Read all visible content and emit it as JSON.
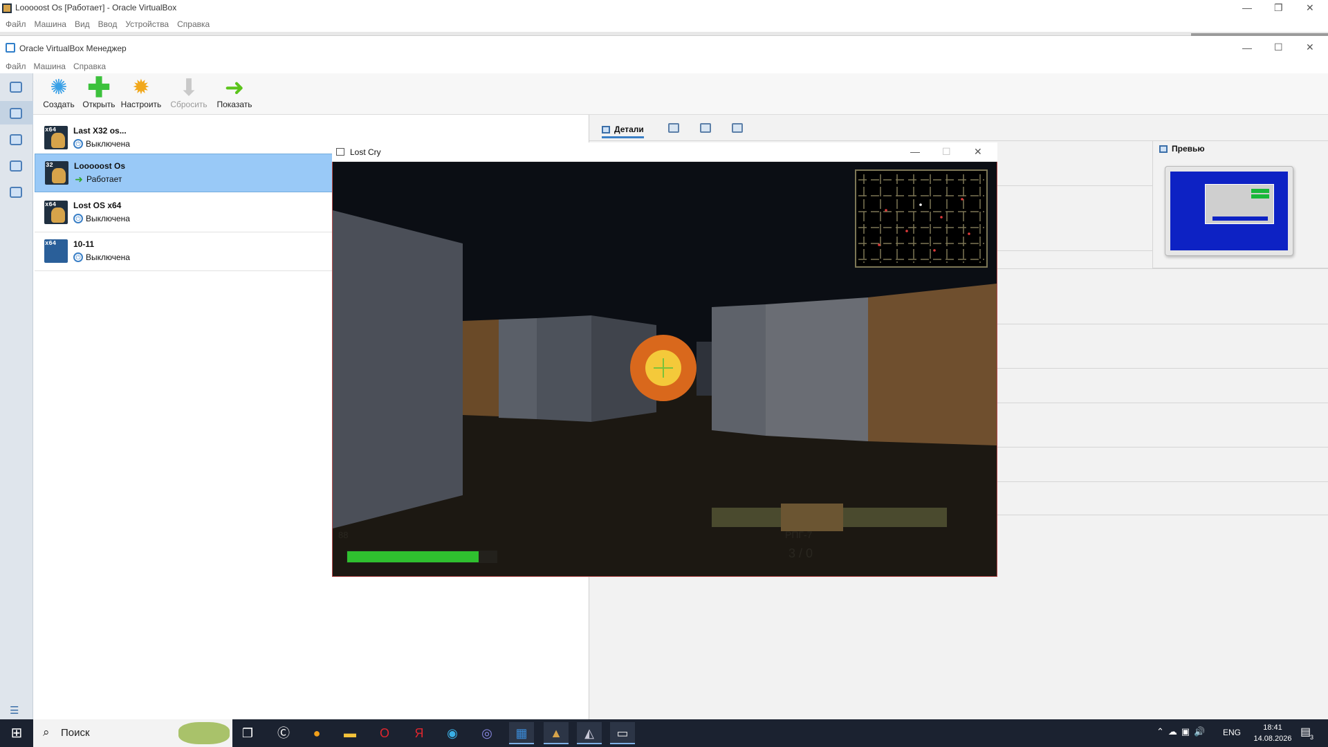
{
  "outer_window": {
    "title": "Looooost Os [Работает] - Oracle VirtualBox",
    "menu": [
      "Файл",
      "Машина",
      "Вид",
      "Ввод",
      "Устройства",
      "Справка"
    ],
    "controls": {
      "minimize": "—",
      "restore": "❐",
      "close": "✕"
    }
  },
  "manager": {
    "title": "Oracle VirtualBox Менеджер",
    "menu": [
      "Файл",
      "Машина",
      "Справка"
    ],
    "controls": {
      "minimize": "—",
      "maximize": "☐",
      "close": "✕"
    },
    "toolbar": [
      {
        "label": "Создать",
        "icon": "new-gear-icon",
        "disabled": false
      },
      {
        "label": "Открыть",
        "icon": "add-plus-icon",
        "disabled": false
      },
      {
        "label": "Настроить",
        "icon": "settings-gear-icon",
        "disabled": false
      },
      {
        "label": "Сбросить",
        "icon": "discard-arrow-icon",
        "disabled": true
      },
      {
        "label": "Показать",
        "icon": "show-arrow-icon",
        "disabled": false
      }
    ],
    "vms": [
      {
        "name": "Last X32 os...",
        "badge": "x64",
        "state": "Выключена",
        "state_icon": "powered-off-icon",
        "selected": false
      },
      {
        "name": "Looooost Os",
        "badge": "32",
        "state": "Работает",
        "state_icon": "running-arrow-icon",
        "selected": true
      },
      {
        "name": "Lost OS x64",
        "badge": "x64",
        "state": "Выключена",
        "state_icon": "powered-off-icon",
        "selected": false
      },
      {
        "name": "10-11",
        "badge": "x64",
        "state": "Выключена",
        "state_icon": "powered-off-icon",
        "selected": false
      }
    ],
    "details_tab": "Детали",
    "preview_title": "Превью"
  },
  "game_window": {
    "title": "Lost Cry",
    "controls": {
      "minimize": "—",
      "maximize": "☐",
      "close": "✕"
    },
    "hud": {
      "health": 88,
      "health_fraction": 0.88,
      "weapon": "РПГ-7",
      "ammo": "3 / 0"
    }
  },
  "taskbar": {
    "search_placeholder": "Поиск",
    "apps": [
      "task-view-icon",
      "browser-c-icon",
      "yandex-icon",
      "file-explorer-icon",
      "opera-icon",
      "yandex-browser-icon",
      "edge-icon",
      "camera-app-icon",
      "virtualbox-icon",
      "vm-app-icon",
      "game-app-icon",
      "window-app-icon"
    ],
    "lang": "ENG",
    "time": "18:41",
    "date": "14.08.2026",
    "notification_count": "3"
  },
  "colors": {
    "selected_row": "#99c9f7",
    "health_bar": "#2fc02f",
    "taskbar": "#1b2230",
    "preview_screen": "#0d22c4"
  }
}
